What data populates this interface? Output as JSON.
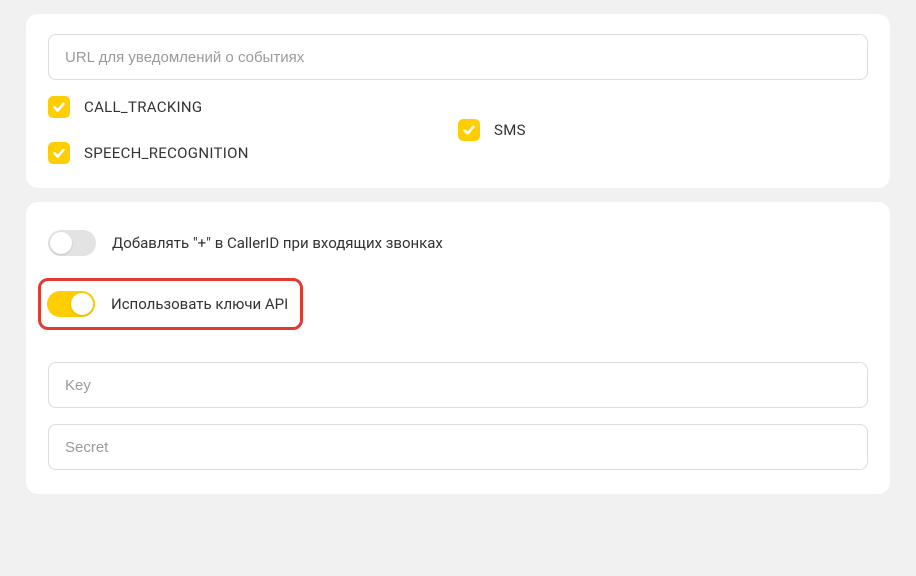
{
  "notifications": {
    "url_placeholder": "URL для уведомлений о событиях",
    "checkboxes": {
      "call_tracking": {
        "label": "CALL_TRACKING",
        "checked": true
      },
      "speech_recognition": {
        "label": "SPEECH_RECOGNITION",
        "checked": true
      },
      "sms": {
        "label": "SMS",
        "checked": true
      }
    }
  },
  "api_section": {
    "toggles": {
      "add_plus_callerid": {
        "label": "Добавлять \"+\" в CallerID при входящих звонках",
        "enabled": false
      },
      "use_api_keys": {
        "label": "Использовать ключи API",
        "enabled": true
      }
    },
    "key_placeholder": "Key",
    "secret_placeholder": "Secret"
  },
  "colors": {
    "accent": "#ffce00",
    "highlight_border": "#e33a2f"
  }
}
